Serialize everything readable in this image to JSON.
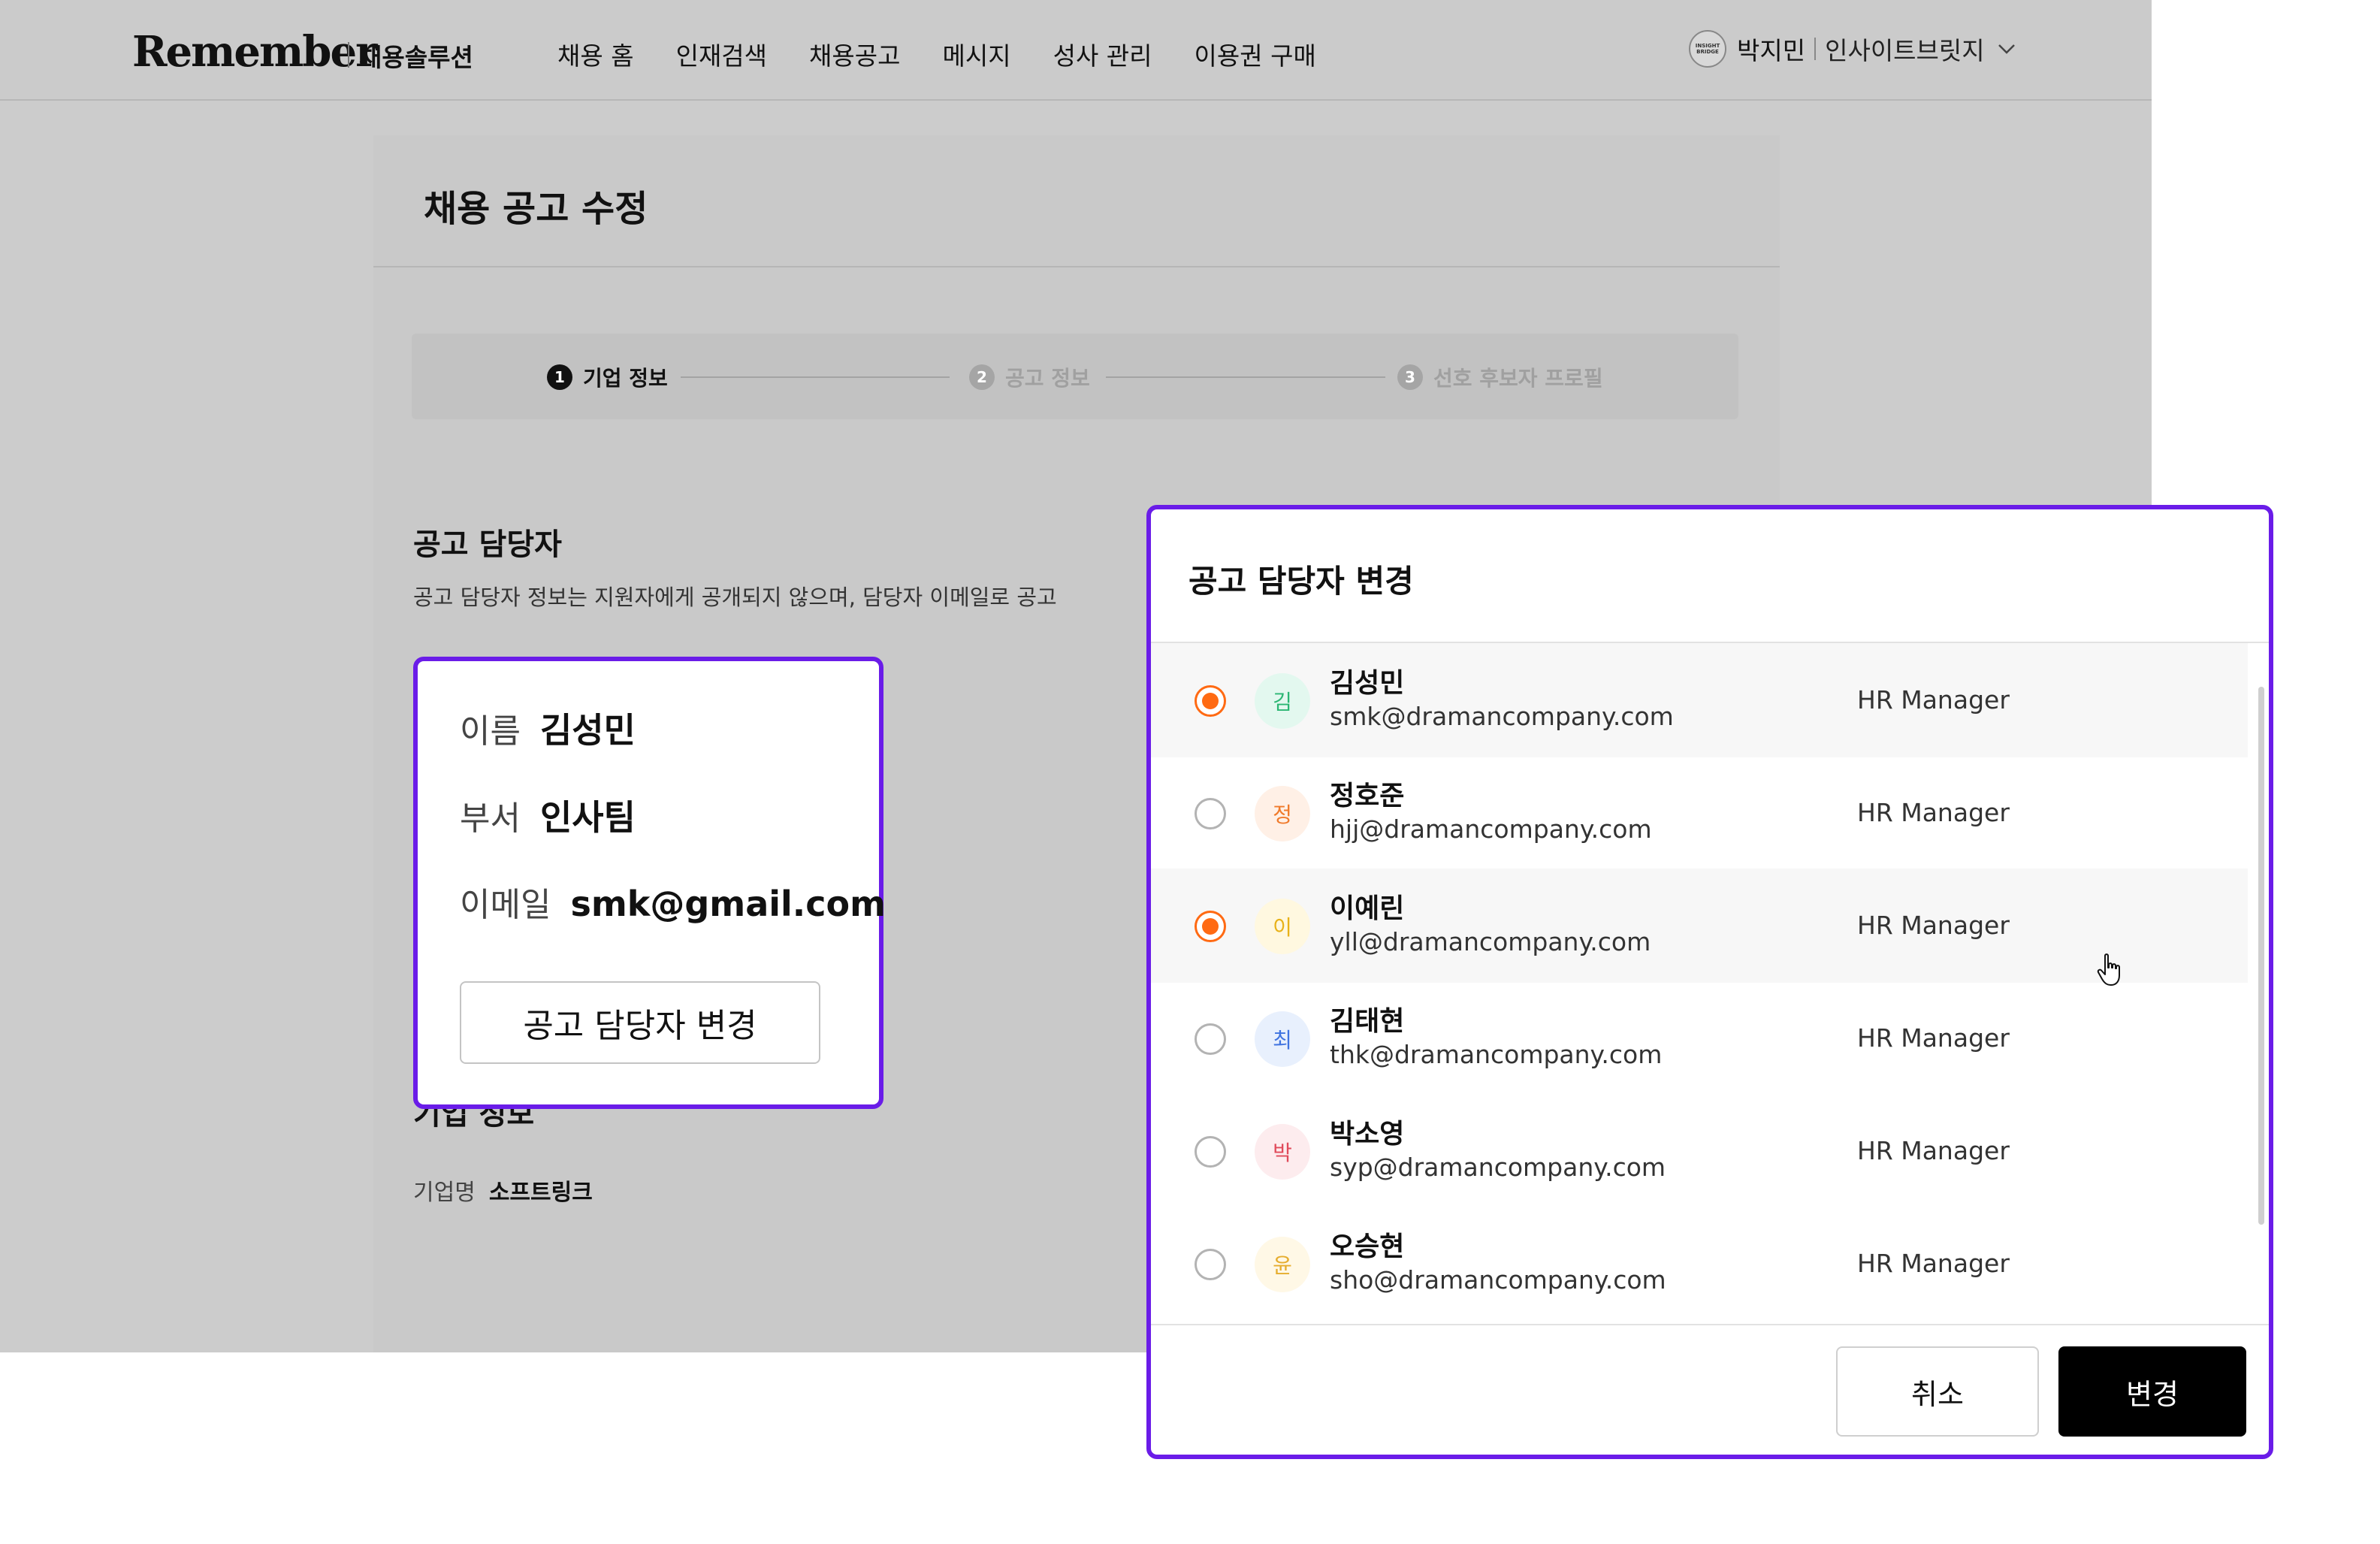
{
  "header": {
    "logo": "Remember",
    "product": "채용솔루션",
    "nav": [
      "채용 홈",
      "인재검색",
      "채용공고",
      "메시지",
      "성사 관리",
      "이용권 구매"
    ],
    "user": {
      "avatar_text": "INSIGHT BRIDGE",
      "name": "박지민",
      "company": "인사이트브릿지",
      "dropdown_icon": "chevron-down-icon"
    }
  },
  "page": {
    "title": "채용 공고 수정",
    "steps": [
      {
        "num": "1",
        "label": "기업 정보",
        "active": true
      },
      {
        "num": "2",
        "label": "공고 정보",
        "active": false
      },
      {
        "num": "3",
        "label": "선호 후보자 프로필",
        "active": false
      }
    ],
    "manager_section": {
      "title": "공고 담당자",
      "desc": "공고 담당자 정보는 지원자에게 공개되지 않으며, 담당자 이메일로 공고"
    },
    "manager_card": {
      "name_label": "이름",
      "name_value": "김성민",
      "dept_label": "부서",
      "dept_value": "인사팀",
      "email_label": "이메일",
      "email_value": "smk@gmail.com",
      "change_button": "공고 담당자 변경"
    },
    "company_section": {
      "title": "기업 정보",
      "name_label": "기업명",
      "name_value": "소프트링크"
    }
  },
  "modal": {
    "title": "공고 담당자 변경",
    "people": [
      {
        "initial": "김",
        "name": "김성민",
        "email": "smk@dramancompany.com",
        "role": "HR Manager",
        "selected": true,
        "avatar_bg": "#e3f8ef",
        "avatar_fg": "#2bb673"
      },
      {
        "initial": "정",
        "name": "정호준",
        "email": "hjj@dramancompany.com",
        "role": "HR Manager",
        "selected": false,
        "avatar_bg": "#fff0e6",
        "avatar_fg": "#f07a2a"
      },
      {
        "initial": "이",
        "name": "이예린",
        "email": "yll@dramancompany.com",
        "role": "HR Manager",
        "selected": true,
        "avatar_bg": "#fff8e0",
        "avatar_fg": "#e8b21a"
      },
      {
        "initial": "최",
        "name": "김태현",
        "email": "thk@dramancompany.com",
        "role": "HR Manager",
        "selected": false,
        "avatar_bg": "#e8f0fd",
        "avatar_fg": "#3f73e0"
      },
      {
        "initial": "박",
        "name": "박소영",
        "email": "syp@dramancompany.com",
        "role": "HR Manager",
        "selected": false,
        "avatar_bg": "#fdecee",
        "avatar_fg": "#e04a5a"
      },
      {
        "initial": "윤",
        "name": "오승현",
        "email": "sho@dramancompany.com",
        "role": "HR Manager",
        "selected": false,
        "avatar_bg": "#fff8e6",
        "avatar_fg": "#e6ad2e"
      }
    ],
    "cancel_button": "취소",
    "confirm_button": "변경"
  },
  "colors": {
    "highlight": "#6a1ce8",
    "radio_selected": "#ff6a13",
    "primary_button": "#000000"
  }
}
